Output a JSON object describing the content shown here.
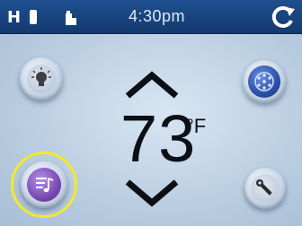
{
  "status_bar": {
    "left_label": "H",
    "time": "4:30pm",
    "icons": [
      "heater-icon",
      "filter-icon",
      "sync-icon"
    ]
  },
  "controls": {
    "light": {
      "icon": "light-bulb-icon"
    },
    "jets": {
      "icon": "jets-icon"
    },
    "music": {
      "icon": "music-icon"
    },
    "settings": {
      "icon": "settings-wrench-icon"
    }
  },
  "temperature": {
    "value": "73",
    "unit": "°F"
  },
  "colors": {
    "status_bar": "#123a6e",
    "highlight_ring": "#f2e92a",
    "jets_blue": "#2a4fa8",
    "music_purple": "#7a4ab2"
  }
}
